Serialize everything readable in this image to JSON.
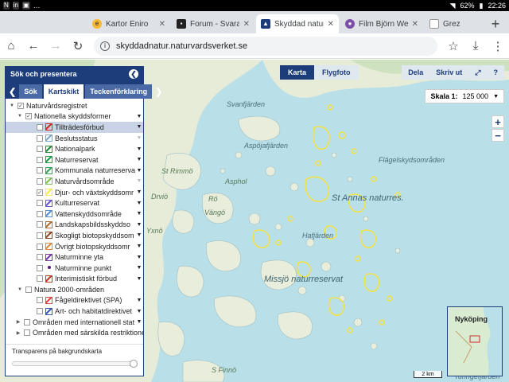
{
  "statusbar": {
    "left_icons": [
      "N",
      "in",
      "▣",
      "…"
    ],
    "battery": "62%",
    "time": "22:26"
  },
  "tabs": [
    {
      "label": "Kartor Eniro",
      "favicon": "eniro-icon",
      "color": "#f7b731",
      "active": false
    },
    {
      "label": "Forum - Svara p",
      "favicon": "forum-icon",
      "color": "#222222",
      "active": false
    },
    {
      "label": "Skyddad natur",
      "favicon": "naturvardsverket-icon",
      "color": "#1c3d7a",
      "active": true
    },
    {
      "label": "Film Björn Wess",
      "favicon": "film-icon",
      "color": "#7b4fa8",
      "active": false
    },
    {
      "label": "Grez",
      "favicon": "page-icon",
      "color": "#999999",
      "active": false
    }
  ],
  "address": {
    "url": "skyddadnatur.naturvardsverket.se"
  },
  "panel": {
    "title": "Sök och presentera",
    "tabs": [
      "Sök",
      "Kartskikt",
      "Teckenförklaring"
    ],
    "active_tab": "Kartskikt",
    "rows": [
      {
        "label": "Naturvårdsregistret",
        "level": 0,
        "expander": "▼",
        "checked": true
      },
      {
        "label": "Nationella skyddsformer",
        "level": 1,
        "expander": "▼",
        "checked": true
      },
      {
        "label": "Tillträdesförbud",
        "level": 2,
        "checked": false,
        "symbol": "#d42a2a",
        "selected": true
      },
      {
        "label": "Beslutsstatus",
        "level": 2,
        "checked": false,
        "symbol": "#7fa7c9",
        "dd_light": true
      },
      {
        "label": "Nationalpark",
        "level": 2,
        "checked": false,
        "symbol": "#2b8a3e"
      },
      {
        "label": "Naturreservat",
        "level": 2,
        "checked": false,
        "symbol": "#2b9a48"
      },
      {
        "label": "Kommunala naturreserva",
        "level": 2,
        "checked": false,
        "symbol": "#3aa35a"
      },
      {
        "label": "Naturvårdsområde",
        "level": 2,
        "checked": false,
        "symbol": "#7fbf5a",
        "dd_light": true
      },
      {
        "label": "Djur- och växtskyddsomr",
        "level": 2,
        "checked": true,
        "symbol": "#f3e95a"
      },
      {
        "label": "Kulturreservat",
        "level": 2,
        "checked": false,
        "symbol": "#6a5acd"
      },
      {
        "label": "Vattenskyddsområde",
        "level": 2,
        "checked": false,
        "symbol": "#5a8fd6"
      },
      {
        "label": "Landskapsbildsskyddso",
        "level": 2,
        "checked": false,
        "symbol": "#b06c3a"
      },
      {
        "label": "Skogligt biotopskyddsom",
        "level": 2,
        "checked": false,
        "symbol": "#8a4a2a"
      },
      {
        "label": "Övrigt biotopskyddsomr",
        "level": 2,
        "checked": false,
        "symbol": "#e08a3a"
      },
      {
        "label": "Naturminne yta",
        "level": 2,
        "checked": false,
        "symbol": "#7a3aa0"
      },
      {
        "label": "Naturminne punkt",
        "level": 2,
        "checked": false,
        "symbol": "#5a1a7a",
        "point": true
      },
      {
        "label": "Interimistiskt förbud",
        "level": 2,
        "checked": false,
        "symbol": "#c0392b"
      },
      {
        "label": "Natura 2000-områden",
        "level": 1,
        "expander": "▼",
        "checked": false,
        "no_dd": true
      },
      {
        "label": "Fågeldirektivet (SPA)",
        "level": 2,
        "checked": false,
        "symbol": "#d94a4a"
      },
      {
        "label": "Art- och habitatdirektivet",
        "level": 2,
        "checked": false,
        "symbol": "#3a5ab0"
      },
      {
        "label": "Områden med internationell stat",
        "level": 0,
        "expander": "▶",
        "checked": false,
        "indent_cb": true
      },
      {
        "label": "Områden med särskilda restriktioner",
        "level": 0,
        "expander": "▶",
        "checked": false,
        "indent_cb": true,
        "no_dd": true
      }
    ],
    "transparency_label": "Transparens på bakgrundskarta",
    "transparency_value": 1.0
  },
  "map_toggle": {
    "karta": "Karta",
    "flygfoto": "Flygfoto",
    "active": "Karta"
  },
  "right_buttons": {
    "share": "Dela",
    "print": "Skriv ut",
    "fullscreen": "⤢",
    "help": "?"
  },
  "scale": {
    "label": "Skala 1:",
    "value": "125 000",
    "caret": "▼"
  },
  "zoom": {
    "in": "+",
    "out": "−"
  },
  "overview": {
    "label": "Nyköping"
  },
  "scalebar": {
    "label": "2 km"
  },
  "map_labels": [
    {
      "text": "Svanfjärden"
    },
    {
      "text": "Aspöjafjärden"
    },
    {
      "text": "St Rimmö"
    },
    {
      "text": "Asphol"
    },
    {
      "text": "Rö"
    },
    {
      "text": "Drviö"
    },
    {
      "text": "Vängö"
    },
    {
      "text": "Flägelskydsområden"
    },
    {
      "text": "St Annas naturres."
    },
    {
      "text": "Hafjärden"
    },
    {
      "text": "Missjö naturreservat"
    },
    {
      "text": "S Finnö"
    },
    {
      "text": "Yxnö"
    },
    {
      "text": "Turingefjärden"
    }
  ]
}
